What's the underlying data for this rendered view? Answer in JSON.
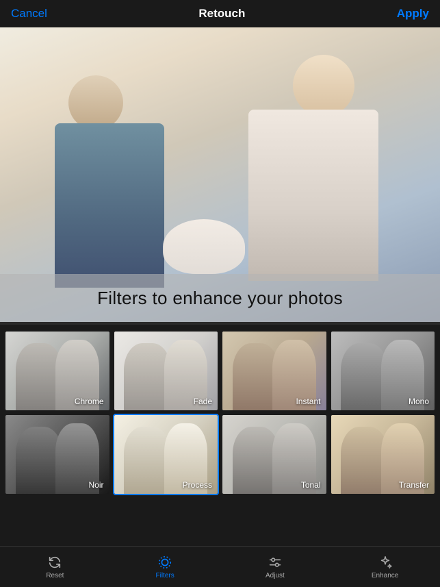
{
  "nav": {
    "cancel_label": "Cancel",
    "title": "Retouch",
    "apply_label": "Apply"
  },
  "photo": {
    "overlay_text": "Filters to enhance your photos"
  },
  "filters": [
    {
      "id": "chrome",
      "label": "Chrome",
      "selected": false,
      "class": "filter-chrome"
    },
    {
      "id": "fade",
      "label": "Fade",
      "selected": false,
      "class": "filter-fade"
    },
    {
      "id": "instant",
      "label": "Instant",
      "selected": false,
      "class": "filter-instant"
    },
    {
      "id": "mono",
      "label": "Mono",
      "selected": false,
      "class": "filter-mono"
    },
    {
      "id": "noir",
      "label": "Noir",
      "selected": false,
      "class": "filter-noir"
    },
    {
      "id": "process",
      "label": "Process",
      "selected": true,
      "class": "filter-process"
    },
    {
      "id": "tonal",
      "label": "Tonal",
      "selected": false,
      "class": "filter-tonal"
    },
    {
      "id": "transfer",
      "label": "Transfer",
      "selected": false,
      "class": "filter-transfer"
    }
  ],
  "toolbar": {
    "items": [
      {
        "id": "reset",
        "label": "Reset",
        "active": false
      },
      {
        "id": "filters",
        "label": "Filters",
        "active": true
      },
      {
        "id": "adjust",
        "label": "Adjust",
        "active": false
      },
      {
        "id": "enhance",
        "label": "Enhance",
        "active": false
      }
    ]
  }
}
